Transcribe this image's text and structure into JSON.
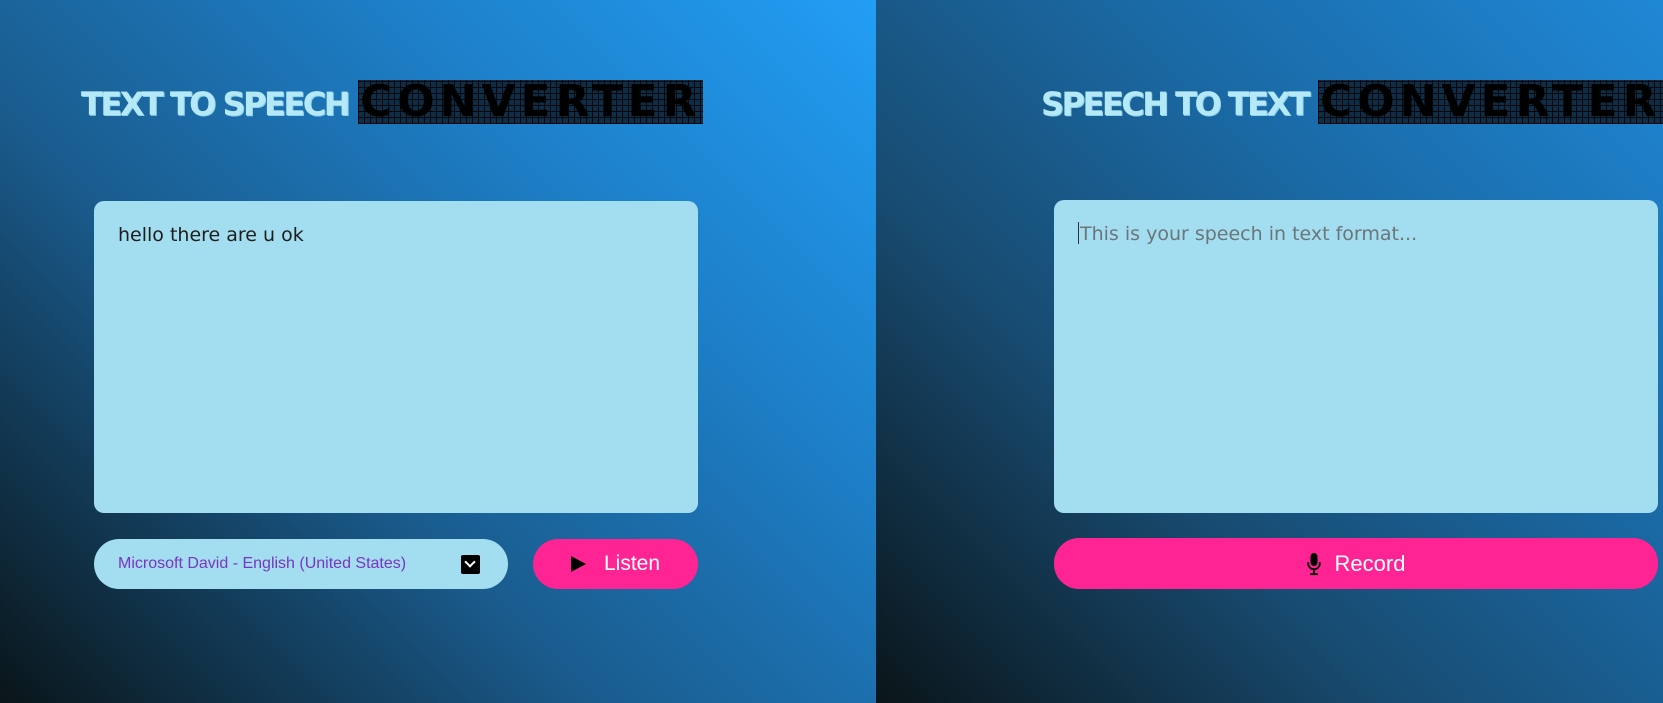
{
  "tts_panel": {
    "heading_light": "TEXT TO SPEECH",
    "heading_dark": "CONVERTER",
    "text_value": "hello there are u ok",
    "voice_select": {
      "selected": "Microsoft David - English (United States)",
      "icon": "chevron-down-icon"
    },
    "listen_button": {
      "label": "Listen",
      "icon": "play-icon"
    }
  },
  "stt_panel": {
    "heading_light": "SPEECH TO TEXT",
    "heading_dark": "CONVERTER",
    "text_placeholder": "This is your speech in text format...",
    "record_button": {
      "label": "Record",
      "icon": "microphone-icon"
    }
  },
  "colors": {
    "accent_pink": "#ff2493",
    "textbox_bg": "#a3ddf0",
    "select_text": "#7a35c4",
    "heading_light": "#b5e9f7"
  }
}
